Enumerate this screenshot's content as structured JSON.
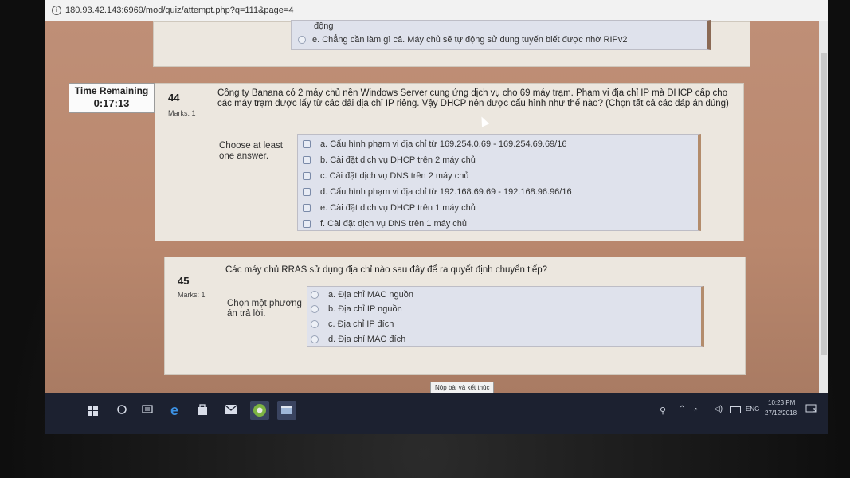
{
  "browser": {
    "url": "180.93.42.143:6969/mod/quiz/attempt.php?q=111&page=4"
  },
  "prev_question": {
    "option_cont": "động",
    "option_e": "e. Chẳng cần làm gì cả. Máy chủ sẽ tự động sử dụng tuyến biết được nhờ RIPv2"
  },
  "timer": {
    "label": "Time Remaining",
    "value": "0:17:13"
  },
  "q44": {
    "number": "44",
    "marks": "Marks: 1",
    "text": "Công ty Banana có 2 máy chủ nền Windows Server cung ứng dịch vụ cho 69 máy trạm. Phạm vi địa chỉ IP mà DHCP cấp cho các máy trạm được lấy từ các dải địa chỉ IP riêng. Vậy DHCP nên được cấu hình như thế nào? (Chọn tất cả các đáp án đúng)",
    "prompt": "Choose at least one answer.",
    "options": [
      "a. Cấu hình phạm vi địa chỉ từ 169.254.0.69 - 169.254.69.69/16",
      "b. Cài đặt dịch vụ DHCP trên 2 máy chủ",
      "c. Cài đặt dịch vụ DNS trên 2 máy chủ",
      "d. Cấu hình phạm vi địa chỉ từ 192.168.69.69 - 192.168.96.96/16",
      "e. Cài đặt dịch vụ DHCP trên 1 máy chủ",
      "f. Cài đặt dịch vụ DNS trên 1 máy chủ"
    ]
  },
  "q45": {
    "number": "45",
    "marks": "Marks: 1",
    "text": "Các máy chủ RRAS sử dụng địa chỉ nào sau đây để ra quyết định chuyển tiếp?",
    "prompt": "Chọn một phương án trả lời.",
    "options": [
      "a. Địa chỉ MAC nguồn",
      "b. Địa chỉ IP nguồn",
      "c. Địa chỉ IP đích",
      "d. Địa chỉ MAC đích"
    ]
  },
  "submit_label": "Nộp bài và kết thúc",
  "taskbar": {
    "language": "ENG",
    "time": "10:23 PM",
    "date": "27/12/2018",
    "notifications": "3",
    "icons": [
      "windows-start-icon",
      "search-circle-icon",
      "task-view-icon",
      "edge-browser-icon",
      "store-icon",
      "mail-icon",
      "chrome-icon",
      "app-icon"
    ]
  },
  "colors": {
    "page_bg": "#bf8f77",
    "panel_bg": "#ece7df",
    "answer_bg": "#dfe2ec",
    "taskbar_bg": "#1c2130"
  }
}
